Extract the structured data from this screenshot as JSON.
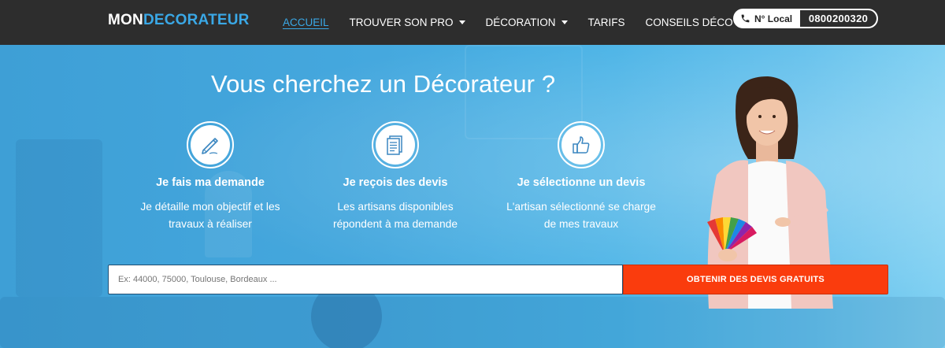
{
  "brand": {
    "part1": "MON",
    "part2": "DECORATEUR"
  },
  "nav": {
    "items": [
      {
        "label": "ACCUEIL",
        "active": true,
        "dropdown": false
      },
      {
        "label": "TROUVER SON PRO",
        "active": false,
        "dropdown": true
      },
      {
        "label": "DÉCORATION",
        "active": false,
        "dropdown": true
      },
      {
        "label": "TARIFS",
        "active": false,
        "dropdown": false
      },
      {
        "label": "CONSEILS DÉCO",
        "active": false,
        "dropdown": false
      }
    ]
  },
  "phone": {
    "label": "N° Local",
    "number": "0800200320",
    "icon": "phone-icon"
  },
  "hero": {
    "title": "Vous cherchez un Décorateur ?",
    "steps": [
      {
        "icon": "pencil-icon",
        "title": "Je fais ma demande",
        "desc_line1": "Je détaille mon objectif et les",
        "desc_line2": "travaux à réaliser"
      },
      {
        "icon": "document-icon",
        "title": "Je reçois des devis",
        "desc_line1": "Les artisans disponibles",
        "desc_line2": "répondent à ma demande"
      },
      {
        "icon": "thumbs-up-icon",
        "title": "Je sélectionne un devis",
        "desc_line1": "L'artisan sélectionné se charge",
        "desc_line2": "de mes travaux"
      }
    ]
  },
  "search": {
    "placeholder": "Ex: 44000, 75000, Toulouse, Bordeaux ...",
    "value": ""
  },
  "cta": {
    "label": "OBTENIR DES DEVIS GRATUITS"
  },
  "colors": {
    "navbar": "#2d2d2d",
    "accent": "#3aa8e6",
    "cta": "#fa3c0d",
    "hero": "#45a8de"
  }
}
